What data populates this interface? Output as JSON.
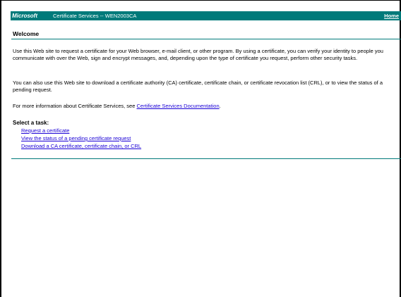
{
  "header": {
    "brand": "Microsoft",
    "product": "Certificate Services  --  WEN2003CA",
    "home_link": "Home"
  },
  "welcome": {
    "title": "Welcome"
  },
  "paragraphs": {
    "intro": "Use this Web site to request a certificate for your Web browser, e-mail client, or other program. By using a certificate, you can verify your identity to people you communicate with over the Web, sign and encrypt messages, and, depending upon the type of certificate you request, perform other security tasks.",
    "download": "You can also use this Web site to download a certificate authority (CA) certificate, certificate chain, or certificate revocation list (CRL), or to view the status of a pending request.",
    "more_info_prefix": "For more information about Certificate Services, see ",
    "more_info_link": "Certificate Services Documentation",
    "more_info_suffix": "."
  },
  "tasks": {
    "heading": "Select a task:",
    "items": [
      {
        "label": "Request a certificate"
      },
      {
        "label": "View the status of a pending certificate request"
      },
      {
        "label": "Download a CA certificate, certificate chain, or CRL"
      }
    ]
  },
  "colors": {
    "header_bg": "#007a7a",
    "link": "#1a00d6"
  }
}
